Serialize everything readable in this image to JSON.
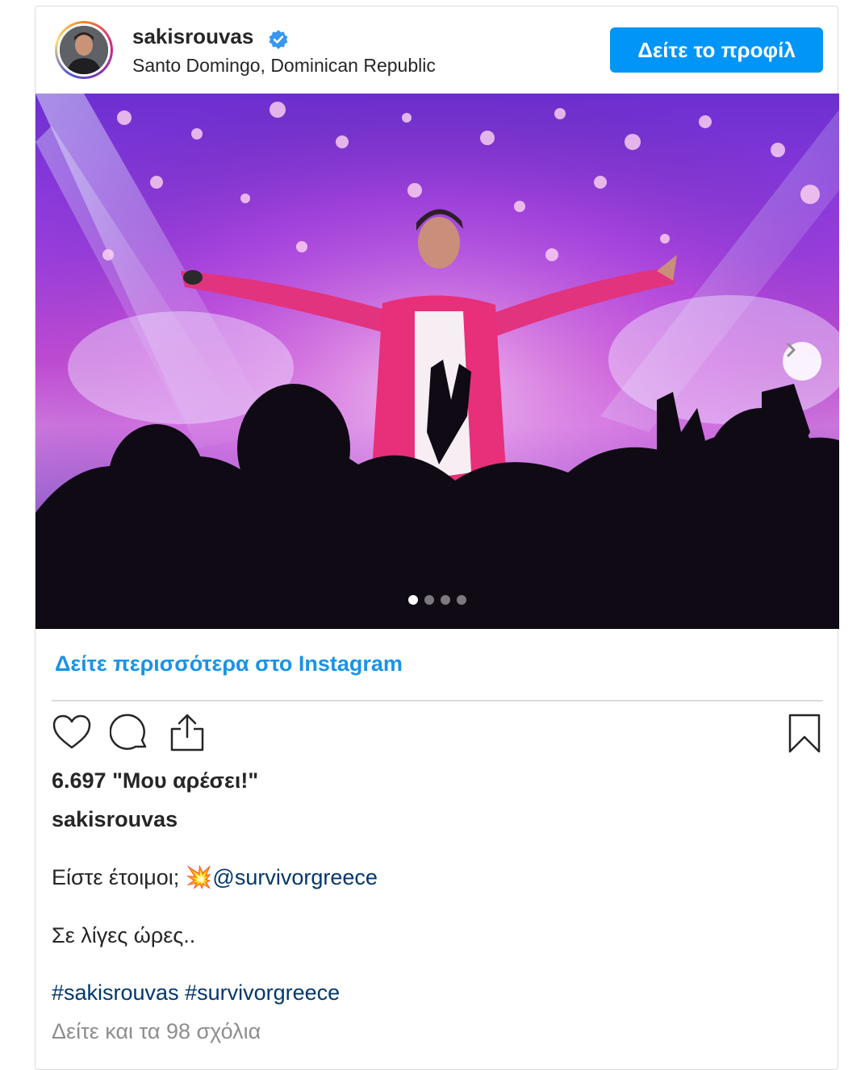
{
  "header": {
    "username": "sakisrouvas",
    "location": "Santo Domingo, Dominican Republic",
    "view_profile_label": "Δείτε το προφίλ"
  },
  "carousel": {
    "slide_count": 4,
    "active_index": 0
  },
  "more_link": "Δείτε περισσότερα στο Instagram",
  "likes_text": "6.697 \"Μου αρέσει!\"",
  "caption": {
    "username": "sakisrouvas",
    "line1_text": "Είστε έτοιμοι; ",
    "emoji": "💥",
    "mention": "@survivorgreece",
    "line2_text": "Σε λίγες ώρες..",
    "hashtag1": "#sakisrouvas",
    "hashtag2": "#survivorgreece"
  },
  "comments_link": "Δείτε και τα 98 σχόλια",
  "colors": {
    "accent": "#0095f6",
    "link": "#1a93e6",
    "mention": "#00376b",
    "muted": "#8e8e8e"
  },
  "icons": [
    "verified-badge-icon",
    "chevron-right-icon",
    "heart-icon",
    "comment-icon",
    "share-icon",
    "bookmark-icon"
  ]
}
